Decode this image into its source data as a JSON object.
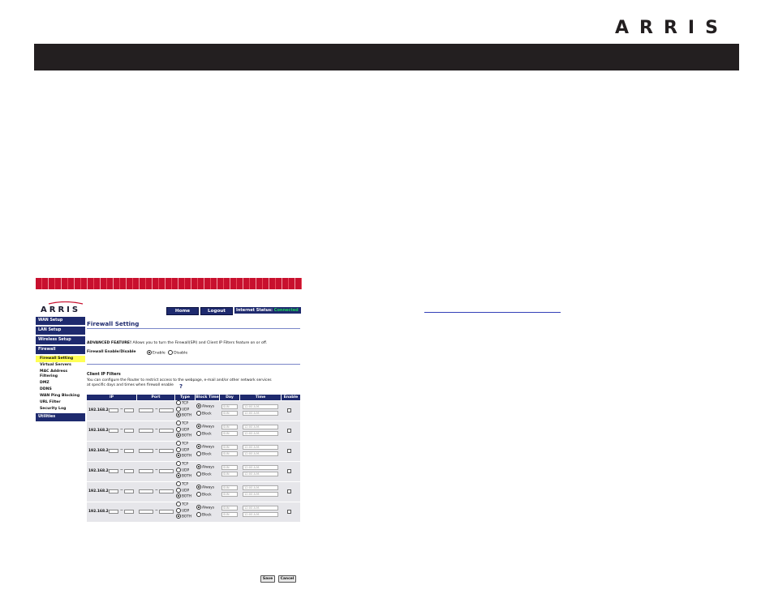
{
  "page": {
    "brand": "ARRIS",
    "colors": {
      "header_bar": "#231f20",
      "link": "#3340b8"
    }
  },
  "router_ui": {
    "logo": "ARRIS",
    "nav": {
      "home": "Home",
      "logout": "Logout",
      "status_label": "Internet Status:",
      "status_value": "Connected"
    },
    "sidebar": {
      "wan_setup": "WAN Setup",
      "lan_setup": "LAN Setup",
      "wireless_setup": "Wireless Setup",
      "firewall": "Firewall",
      "firewall_setting": "Firewall Setting",
      "virtual_servers": "Virtual Servers",
      "mac_filtering_1": "MAC Address",
      "mac_filtering_2": "Filtering",
      "dmz": "DMZ",
      "ddns": "DDNS",
      "wan_ping": "WAN Ping Blocking",
      "url_filter": "URL Filter",
      "security_log": "Security Log",
      "utilities": "Utilities"
    },
    "title": "Firewall Setting",
    "advanced_bold": "ADVANCED FEATURE!",
    "advanced_text": " Allows you to turn the Firewall(SPI) and Client IP Filters feature on or off.",
    "fw_label": "Firewall Enable/Disable",
    "fw_enable": "Enable",
    "fw_disable": "Disable",
    "client_title": "Client IP Filters",
    "client_desc": "You can configure the Router to restrict access to the webpage, e-mail and/or other network services at specific days and times when firewall enable",
    "help_icon": "?",
    "table": {
      "headers": [
        "IP",
        "Port",
        "Type",
        "Block Time",
        "Day",
        "Time",
        "Enable"
      ],
      "ip_prefix": "192.168.2.",
      "dash": "~",
      "type_options": [
        "TCP",
        "UDP",
        "BOTH"
      ],
      "block_options": [
        "Always",
        "Block"
      ],
      "day_value": "SUN",
      "time_value": "12:00 A.M."
    },
    "save": "Save",
    "cancel": "Cancel"
  }
}
